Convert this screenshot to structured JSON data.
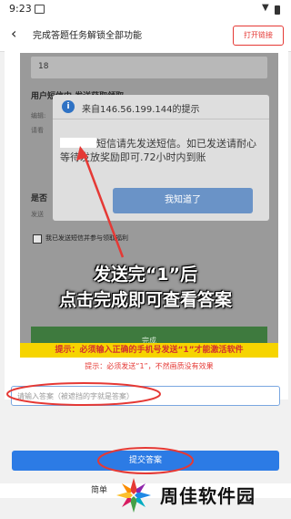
{
  "status_bar": {
    "time": "9:23"
  },
  "header": {
    "title": "完成答题任务解锁全部功能",
    "back_icon": "chevron-left-icon",
    "open_link_label": "打开链接"
  },
  "screenshot": {
    "phone_value": "18",
    "bg_section_title": "用户短信中 发送获取领取",
    "bg_line_1": "编辑:",
    "bg_line_2": "请看",
    "bg_section_2": "是否",
    "bg_line_3": "发送",
    "checkbox_label": "我已发送短信并参与领取福利",
    "bg_button": "完成",
    "dialog": {
      "title": "来自146.56.199.144的提示",
      "message": "短信请先发送短信。如已发送请耐心等待发放奖励即可.72小时内到账",
      "ok_label": "我知道了"
    }
  },
  "overlay": {
    "line1": "发送完“1”后",
    "line2": "点击完成即可查看答案"
  },
  "hints": {
    "hint1": "提示：必须输入正确的手机号发送“1”才能激活软件",
    "hint2": "提示：必须发送“1”，不然画质没有效果"
  },
  "answer_input": {
    "placeholder": "请输入答案（被遮挡的字就是答案）"
  },
  "submit_label": "提交答案",
  "footer": {
    "left_text": "简单",
    "brand": "周佳软件园"
  },
  "colors": {
    "accent": "#2c7be5",
    "danger": "#e53935",
    "highlight": "#f6d400"
  }
}
